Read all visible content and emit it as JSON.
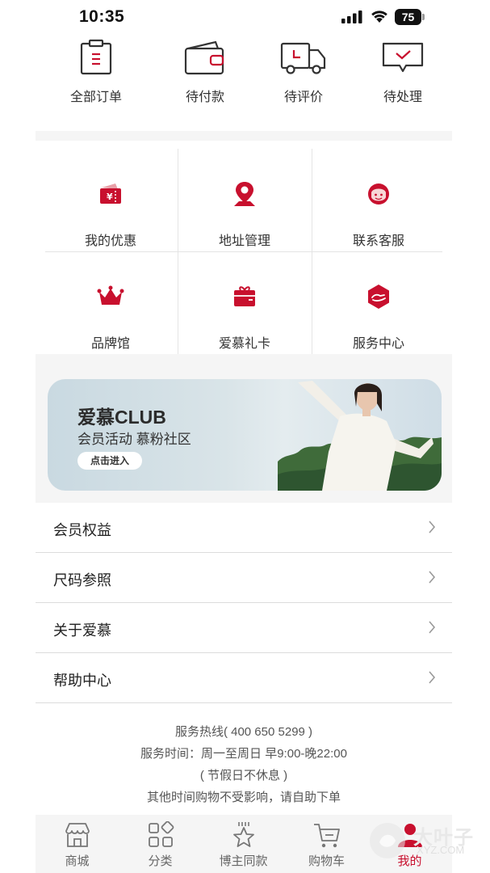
{
  "status_bar": {
    "time": "10:35",
    "battery": "75"
  },
  "orders": [
    {
      "label": "全部订单",
      "icon": "clipboard-icon"
    },
    {
      "label": "待付款",
      "icon": "wallet-icon"
    },
    {
      "label": "待评价",
      "icon": "delivery-truck-icon"
    },
    {
      "label": "待处理",
      "icon": "message-check-icon"
    }
  ],
  "services": [
    {
      "label": "我的优惠",
      "icon": "coupon-icon"
    },
    {
      "label": "地址管理",
      "icon": "location-pin-icon"
    },
    {
      "label": "联系客服",
      "icon": "customer-service-icon"
    },
    {
      "label": "品牌馆",
      "icon": "crown-icon"
    },
    {
      "label": "爱慕礼卡",
      "icon": "gift-card-icon"
    },
    {
      "label": "服务中心",
      "icon": "hand-service-icon"
    }
  ],
  "banner": {
    "title": "爱慕CLUB",
    "subtitle": "会员活动 慕粉社区",
    "button": "点击进入"
  },
  "menu": [
    {
      "label": "会员权益"
    },
    {
      "label": "尺码参照"
    },
    {
      "label": "关于爱慕"
    },
    {
      "label": "帮助中心"
    }
  ],
  "info": {
    "hotline": "服务热线( 400 650 5299 )",
    "hours": "服务时间：周一至周日 早9:00-晚22:00",
    "holiday": "( 节假日不休息 )",
    "note": "其他时间购物不受影响，请自助下单"
  },
  "tabs": [
    {
      "label": "商城",
      "icon": "store-icon"
    },
    {
      "label": "分类",
      "icon": "category-grid-icon"
    },
    {
      "label": "博主同款",
      "icon": "star-icon"
    },
    {
      "label": "购物车",
      "icon": "cart-icon"
    },
    {
      "label": "我的",
      "icon": "profile-icon"
    }
  ],
  "colors": {
    "accent": "#c8102e",
    "background": "#f5f5f5",
    "text": "#333333"
  },
  "watermark": {
    "text": "大叶子",
    "sub": "XYZ.COM"
  }
}
